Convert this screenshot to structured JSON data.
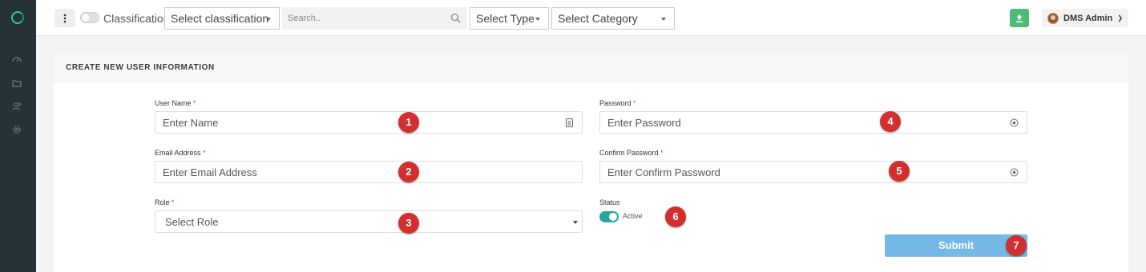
{
  "topbar": {
    "classification_label": "Classification",
    "classification_select": "Select classification",
    "search_placeholder": "Search..",
    "type_select": "Select Type",
    "category_select": "Select Category",
    "user_name": "DMS Admin"
  },
  "form": {
    "title": "CREATE NEW USER INFORMATION",
    "username": {
      "label": "User Name",
      "required": "*",
      "placeholder": "Enter Name"
    },
    "email": {
      "label": "Email Address",
      "required": "*",
      "placeholder": "Enter Email Address"
    },
    "role": {
      "label": "Role",
      "required": "*",
      "value": "Select Role"
    },
    "password": {
      "label": "Password",
      "required": "*",
      "placeholder": "Enter Password"
    },
    "confirm_password": {
      "label": "Confirm Password",
      "required": "*",
      "placeholder": "Enter Confirm Password"
    },
    "status": {
      "label": "Status",
      "value": "Active"
    },
    "submit_label": "Submit"
  },
  "annotations": [
    "1",
    "2",
    "3",
    "4",
    "5",
    "6",
    "7"
  ],
  "colors": {
    "sidebar": "#263238",
    "accent": "#26a69a",
    "submit": "#74b8e8",
    "badge": "#d32f2f",
    "upload": "#4cbc79"
  },
  "icons": [
    "logo-icon",
    "dashboard-icon",
    "folder-icon",
    "users-icon",
    "settings-icon",
    "kebab-icon",
    "search-icon",
    "upload-icon",
    "id-card-icon",
    "eye-icon"
  ]
}
